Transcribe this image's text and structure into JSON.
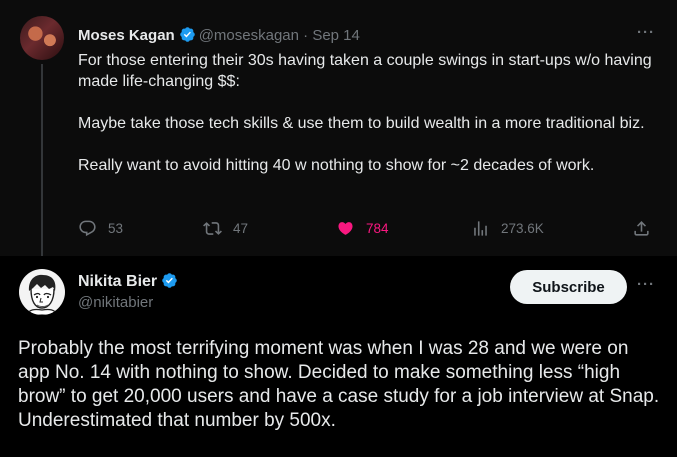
{
  "tweet1": {
    "name": "Moses Kagan",
    "handle": "@moseskagan",
    "date": "· Sep 14",
    "paragraphs": [
      "For those entering their 30s having taken a couple swings in start-ups w/o having made life-changing $$:",
      "Maybe take those tech skills & use them to build wealth in a more traditional biz.",
      "Really want to avoid hitting 40 w nothing to show for ~2 decades of work."
    ],
    "replies": "53",
    "reposts": "47",
    "likes": "784",
    "views": "273.6K",
    "more": "···"
  },
  "tweet2": {
    "name": "Nikita Bier",
    "handle": "@nikitabier",
    "subscribe_label": "Subscribe",
    "more": "···",
    "text": "Probably the most terrifying moment was when I was 28 and we were on app No. 14 with nothing to show. Decided to make something less “high brow” to get 20,000 users and have a case study for a job interview at Snap. Underestimated that number by 500x."
  },
  "colors": {
    "verified": "#1d9bf0",
    "like": "#f91880",
    "muted": "#71767b"
  }
}
